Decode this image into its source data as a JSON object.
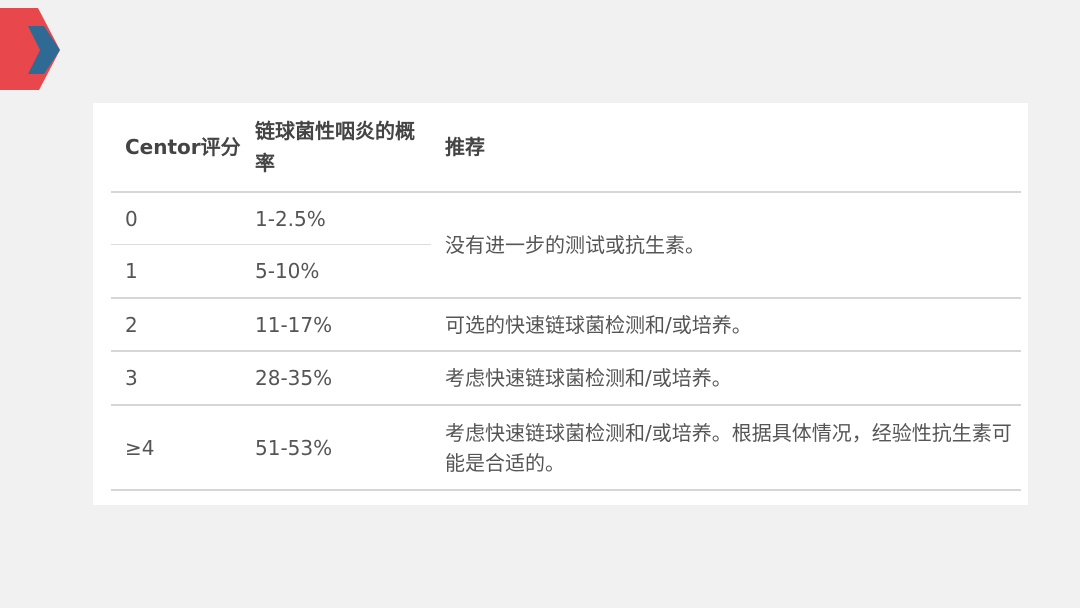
{
  "table": {
    "headers": {
      "score": "Centor评分",
      "probability": "链球菌性咽炎的概率",
      "recommendation": "推荐"
    },
    "rows": [
      {
        "score": "0",
        "probability": "1-2.5%"
      },
      {
        "score": "1",
        "probability": "5-10%"
      },
      {
        "score": "2",
        "probability": "11-17%",
        "recommendation": "可选的快速链球菌检测和/或培养。"
      },
      {
        "score": "3",
        "probability": "28-35%",
        "recommendation": "考虑快速链球菌检测和/或培养。"
      },
      {
        "score": "≥4",
        "probability": "51-53%",
        "recommendation": "考虑快速链球菌检测和/或培养。根据具体情况，经验性抗生素可能是合适的。"
      }
    ],
    "merged_recommendation_0_1": "没有进一步的测试或抗生素。"
  },
  "colors": {
    "background": "#f1f1f1",
    "accent_red": "#e8474c",
    "accent_blue": "#2f6a94"
  }
}
